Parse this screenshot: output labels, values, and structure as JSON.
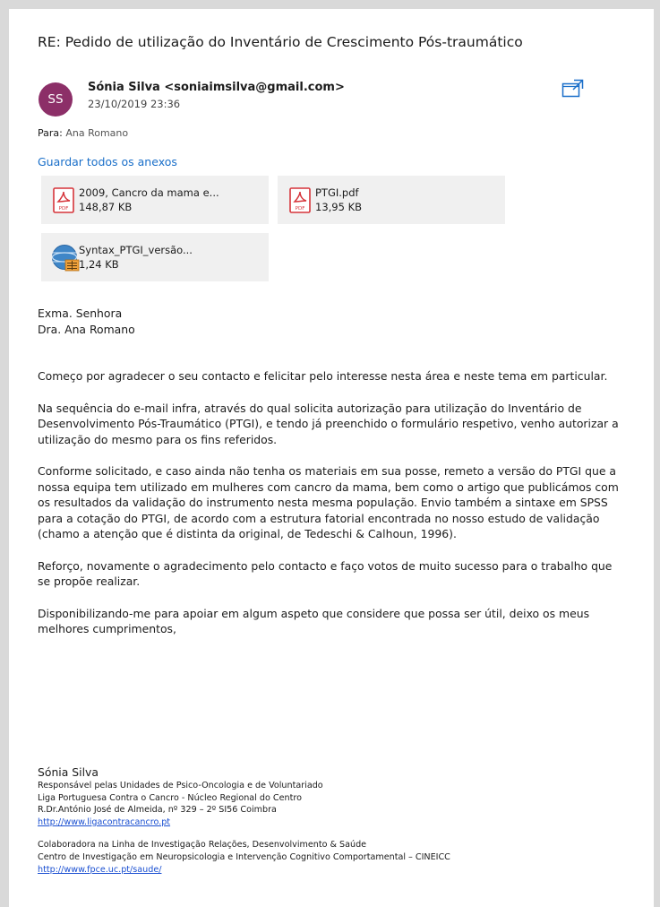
{
  "email": {
    "subject": "RE: Pedido de utilização do Inventário de Crescimento Pós-traumático",
    "avatar_initials": "SS",
    "sender": "Sónia Silva <soniaimsilva@gmail.com>",
    "date": "23/10/2019 23:36",
    "to_label": "Para:",
    "to_value": " Ana Romano",
    "popout_icon": "popout-window-icon",
    "save_all_label": "Guardar todos os anexos"
  },
  "attachments": [
    {
      "name": "2009, Cancro da mama e...",
      "size": "148,87 KB",
      "icon": "pdf-icon",
      "icon_label": "PDF"
    },
    {
      "name": "PTGI.pdf",
      "size": "13,95 KB",
      "icon": "pdf-icon",
      "icon_label": "PDF"
    },
    {
      "name": "Syntax_PTGI_versão...",
      "size": "1,24 KB",
      "icon": "spss-syntax-icon"
    }
  ],
  "body": {
    "salutation_1": "Exma. Senhora",
    "salutation_2": "Dra. Ana Romano",
    "p1": "Começo por agradecer o seu contacto e felicitar pelo interesse nesta área e neste tema em particular.",
    "p2": "Na sequência do e-mail infra, através do qual solicita autorização para utilização do Inventário de Desenvolvimento Pós-Traumático (PTGI), e tendo já preenchido o formulário respetivo, venho autorizar a utilização do mesmo para os fins referidos.",
    "p3": "Conforme solicitado, e caso ainda não tenha os materiais em sua posse, remeto a versão do PTGI que a nossa equipa tem utilizado em mulheres com cancro da mama, bem como o artigo que publicámos com os resultados da validação do instrumento nesta mesma população. Envio também a sintaxe em SPSS para a cotação do PTGI, de acordo com a estrutura fatorial encontrada no nosso estudo de validação (chamo a atenção que é distinta da original, de Tedeschi & Calhoun, 1996).",
    "p4": "Reforço, novamente o agradecimento pelo contacto e faço votos de muito sucesso para o trabalho que se propõe realizar.",
    "p5": "Disponibilizando-me para apoiar em algum aspeto que considere que possa ser útil, deixo os meus melhores cumprimentos,"
  },
  "signature": {
    "name": "Sónia Silva",
    "line1": "Responsável pelas Unidades de Psico-Oncologia e de Voluntariado",
    "line2": "Liga Portuguesa Contra o Cancro - Núcleo Regional do Centro",
    "line3": "R.Dr.António José de Almeida, nº 329 – 2º SI56 Coimbra",
    "link1": "http://www.ligacontracancro.pt",
    "line4": "Colaboradora na Linha de Investigação Relações, Desenvolvimento & Saúde",
    "line5": "Centro de Investigação em Neuropsicologia e Intervenção Cognitivo Comportamental – CINEICC",
    "link2": "http://www.fpce.uc.pt/saude/"
  },
  "colors": {
    "avatar": "#8c2f68",
    "link": "#1a6fc9",
    "attachment_bg": "#f0f0f0",
    "pdf_red": "#d6343a"
  }
}
